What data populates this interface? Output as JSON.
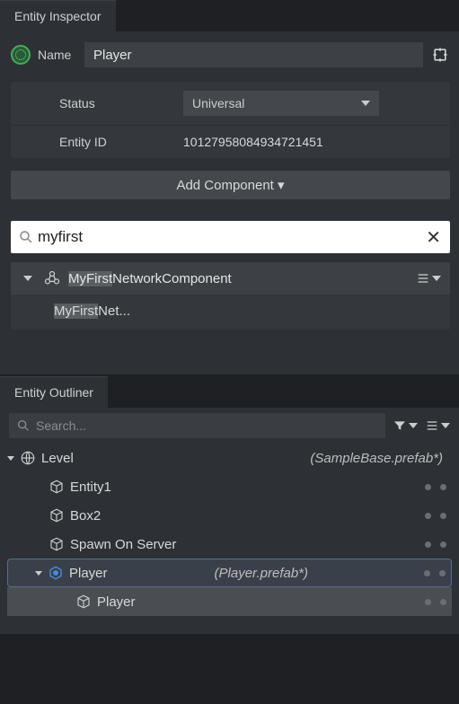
{
  "inspector": {
    "tab_title": "Entity Inspector",
    "name_label": "Name",
    "name_value": "Player",
    "status_label": "Status",
    "status_value": "Universal",
    "entity_id_label": "Entity ID",
    "entity_id_value": "10127958084934721451",
    "add_component_label": "Add Component ▾",
    "search_value": "myfirst",
    "component_group_title_hi": "MyFirst",
    "component_group_title_rest": "NetworkComponent",
    "component_child_hi": "MyFirst",
    "component_child_rest": "Net..."
  },
  "outliner": {
    "tab_title": "Entity Outliner",
    "search_placeholder": "Search...",
    "tree": [
      {
        "label": "Level",
        "prefab": "(SampleBase.prefab*)",
        "icon": "globe",
        "depth": 0,
        "expand": true
      },
      {
        "label": "Entity1",
        "icon": "cube",
        "depth": 1,
        "dots": true
      },
      {
        "label": "Box2",
        "icon": "cube",
        "depth": 1,
        "dots": true
      },
      {
        "label": "Spawn On Server",
        "icon": "cube",
        "depth": 1,
        "dots": true
      },
      {
        "label": "Player",
        "prefab": "(Player.prefab*)",
        "icon": "hex",
        "depth": 1,
        "dots": true,
        "expand": true,
        "selected_group": true
      },
      {
        "label": "Player",
        "icon": "cube",
        "depth": 2,
        "dots": true,
        "selected_child": true
      }
    ]
  }
}
